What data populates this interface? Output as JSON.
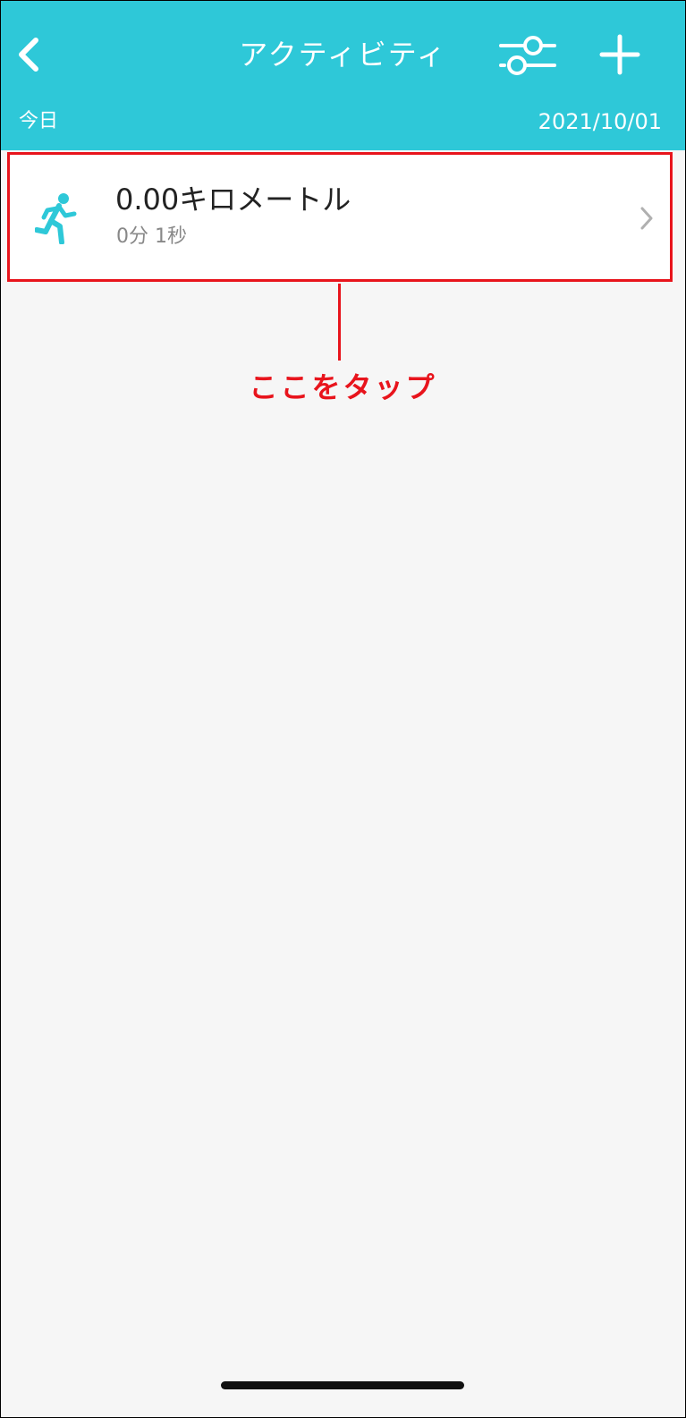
{
  "header": {
    "title": "アクティビティ",
    "back_icon": "chevron-left-icon",
    "filter_icon": "sliders-icon",
    "add_icon": "plus-icon",
    "color": "#2ec8d8"
  },
  "subbar": {
    "left_label": "今日",
    "date": "2021/10/01"
  },
  "activities": [
    {
      "icon": "running-person-icon",
      "distance": "0.00キロメートル",
      "duration": "0分 1秒"
    }
  ],
  "annotation": {
    "text": "ここをタップ",
    "color": "#e8141c"
  }
}
